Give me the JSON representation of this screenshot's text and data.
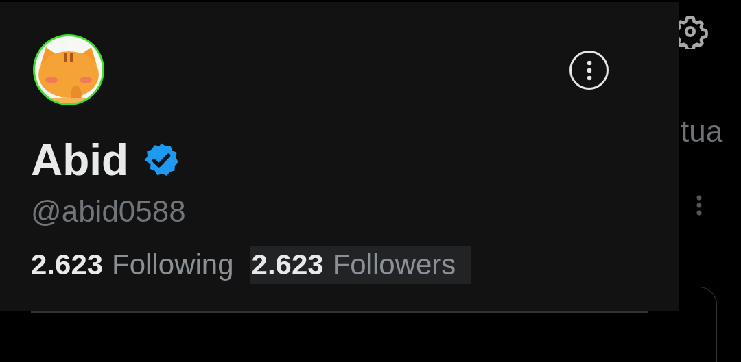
{
  "background": {
    "partial_text": "tua"
  },
  "profile": {
    "name": "Abid",
    "verified": true,
    "handle": "@abid0588",
    "stats": [
      {
        "count": "2.623",
        "label": "Following",
        "highlighted": false
      },
      {
        "count": "2.623",
        "label": "Followers",
        "highlighted": true
      }
    ]
  }
}
